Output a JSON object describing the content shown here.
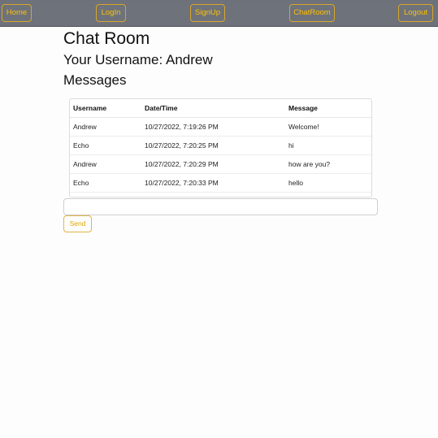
{
  "navbar": {
    "home_label": "Home",
    "login_label": "LogIn",
    "signup_label": "SignUp",
    "chatroom_label": "ChatRoom",
    "logout_label": "Logout",
    "accent_color": "#ffc107",
    "background_color": "#6c7078"
  },
  "page": {
    "title": "Chat Room",
    "username_label": "Your Username: ",
    "username_value": "Andrew",
    "messages_heading": "Messages"
  },
  "messages_table": {
    "headers": [
      "Username",
      "Date/Time",
      "Message"
    ],
    "rows": [
      [
        "Andrew",
        "10/27/2022, 7:19:26 PM",
        "Welcome!"
      ],
      [
        "Echo",
        "10/27/2022, 7:20:25 PM",
        "hi"
      ],
      [
        "Andrew",
        "10/27/2022, 7:20:29 PM",
        "how are you?"
      ],
      [
        "Echo",
        "10/27/2022, 7:20:33 PM",
        "hello"
      ]
    ]
  },
  "composer": {
    "input_value": "",
    "send_label": "Send"
  }
}
